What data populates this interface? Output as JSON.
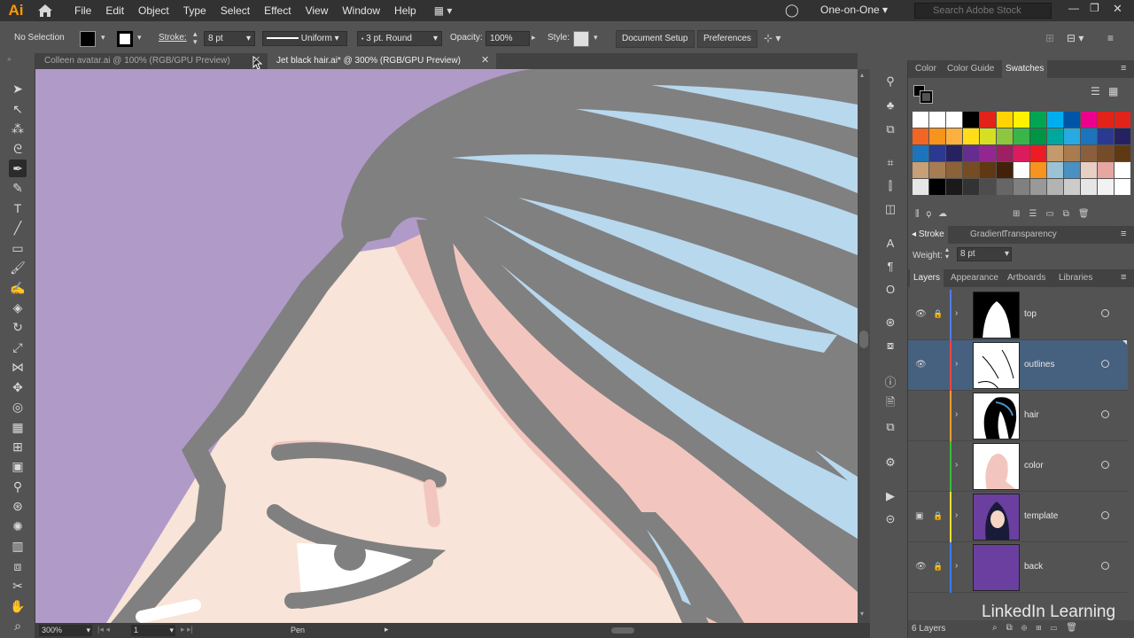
{
  "app": {
    "logo": "Ai"
  },
  "menu": [
    "File",
    "Edit",
    "Object",
    "Type",
    "Select",
    "Effect",
    "View",
    "Window",
    "Help"
  ],
  "workspace": "One-on-One",
  "search": {
    "placeholder": "Search Adobe Stock"
  },
  "control": {
    "selection": "No Selection",
    "stroke_label": "Stroke:",
    "stroke_value": "8 pt",
    "profile": "Uniform",
    "brush": "3 pt. Round",
    "opacity_label": "Opacity:",
    "opacity_value": "100%",
    "style_label": "Style:",
    "document_setup": "Document Setup",
    "preferences": "Preferences"
  },
  "tabs": [
    {
      "label": "Colleen avatar.ai @ 100% (RGB/GPU Preview)",
      "active": false
    },
    {
      "label": "Jet black hair.ai* @ 300% (RGB/GPU Preview)",
      "active": true
    }
  ],
  "status": {
    "zoom": "300%",
    "artboard": "1",
    "tool": "Pen"
  },
  "color_panel": {
    "tabs": [
      "Color",
      "Color Guide",
      "Swatches"
    ],
    "active": "Swatches",
    "swatch_rows": [
      [
        "#ffffff",
        "#ffffff",
        "#ffffff",
        "#000000",
        "#e2231a",
        "#ffd400",
        "#fff200",
        "#00a651",
        "#00aeef",
        "#0054a6",
        "#ec008c",
        "#e2231a",
        "#e2231a"
      ],
      [
        "#f26522",
        "#f7941d",
        "#fbb040",
        "#ffde17",
        "#d7df23",
        "#8dc63f",
        "#39b54a",
        "#009444",
        "#00a79d",
        "#27aae1",
        "#1c75bc",
        "#2b3990",
        "#262262"
      ],
      [
        "#1c75bc",
        "#2b3990",
        "#262262",
        "#662d91",
        "#92278f",
        "#9e1f63",
        "#da1c5c",
        "#ed1c24",
        "#c49a6c",
        "#a97c50",
        "#8b5e3c",
        "#754c29",
        "#603913"
      ],
      [
        "#c7a078",
        "#a67c52",
        "#8c6239",
        "#754c24",
        "#603813",
        "#42210b",
        "#ffffff",
        "#f7941d",
        "#9cc3d5",
        "#4a90c2",
        "#e8cfc4",
        "#e8a6a0",
        "#ffffff"
      ],
      [
        "#e6e6e6",
        "#000000",
        "#1a1a1a",
        "#333333",
        "#4d4d4d",
        "#666666",
        "#808080",
        "#999999",
        "#b3b3b3",
        "#cccccc",
        "#e6e6e6",
        "#f2f2f2",
        "#ffffff"
      ]
    ]
  },
  "stroke_panel": {
    "tabs": [
      "Stroke",
      "Gradient",
      "Transparency"
    ],
    "weight_label": "Weight:",
    "weight_value": "8 pt"
  },
  "layers_panel": {
    "tabs": [
      "Layers",
      "Appearance",
      "Artboards",
      "Libraries"
    ],
    "layers": [
      {
        "name": "top",
        "color": "#4f7cf7",
        "visible": true,
        "locked": true
      },
      {
        "name": "outlines",
        "color": "#f2453d",
        "visible": true,
        "locked": false,
        "selected": true
      },
      {
        "name": "hair",
        "color": "#f79c2c",
        "visible": false,
        "locked": false
      },
      {
        "name": "color",
        "color": "#3bbd3b",
        "visible": false,
        "locked": false
      },
      {
        "name": "template",
        "color": "#e8e030",
        "visible": false,
        "locked": true
      },
      {
        "name": "back",
        "color": "#3a7bf2",
        "visible": true,
        "locked": true
      }
    ],
    "count": "6 Layers"
  },
  "watermark": "LinkedIn Learning",
  "colors": {
    "canvas_bg": "#b09ac8",
    "hair": "#808080",
    "highlight": "#b8d8ee",
    "skin": "#f8e4d8",
    "skin_shadow": "#f2c6be"
  }
}
